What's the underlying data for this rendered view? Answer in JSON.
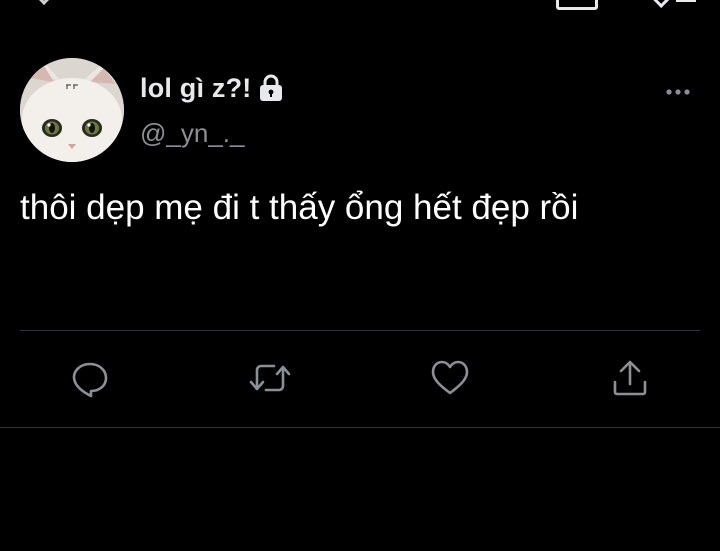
{
  "tweet": {
    "author": {
      "display_name": "lol gì z?!",
      "handle": "@_yn_._",
      "protected_icon": "lock-icon"
    },
    "text": "thôi dẹp mẹ đi t thấy ổng hết đẹp rồi",
    "more_icon": "more-horizontal-icon"
  },
  "actions": [
    {
      "name": "reply",
      "icon": "reply-icon"
    },
    {
      "name": "retweet",
      "icon": "retweet-icon"
    },
    {
      "name": "like",
      "icon": "heart-icon"
    },
    {
      "name": "share",
      "icon": "share-icon"
    }
  ],
  "colors": {
    "background": "#000000",
    "primary_text": "#e7e9ea",
    "secondary_text": "#8b9096",
    "divider": "#2f3336",
    "icon": "#8b9096"
  }
}
